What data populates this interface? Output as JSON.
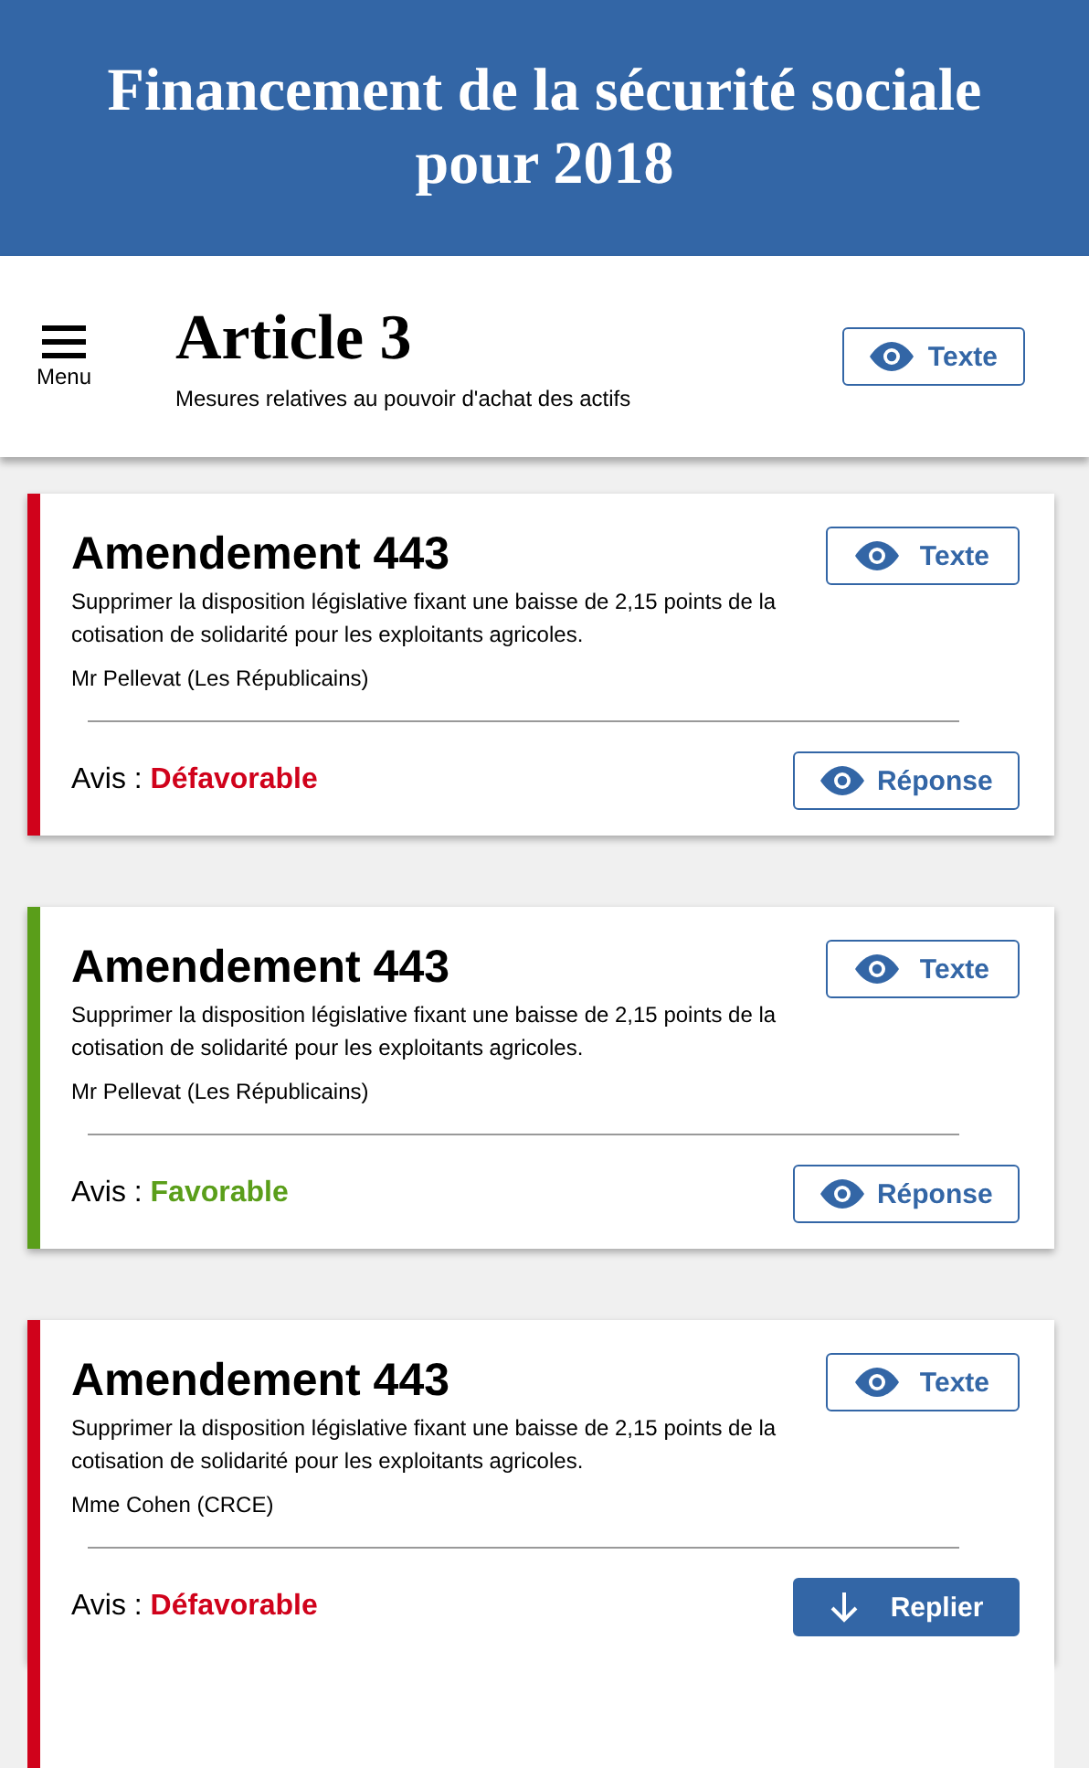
{
  "header": {
    "title": "Financement de la sécurité sociale pour 2018"
  },
  "nav": {
    "menu_label": "Menu",
    "title": "Article 3",
    "subtitle": "Mesures relatives au pouvoir d'achat des actifs",
    "text_button": "Texte"
  },
  "amendments": [
    {
      "title": "Amendement 443",
      "description": "Supprimer la disposition législative fixant une baisse de 2,15 points de la cotisation de solidarité pour les exploitants agricoles.",
      "author": "Mr Pellevat (Les Républicains)",
      "text_button": "Texte",
      "verdict_label": "Avis :",
      "verdict": "Défavorable",
      "color": "#d0021b",
      "expanded": false,
      "response_button": "Réponse"
    },
    {
      "title": "Amendement 443",
      "description": "Supprimer la disposition législative fixant une baisse de 2,15 points de la cotisation de solidarité pour les exploitants agricoles.",
      "author": "Mr Pellevat (Les Républicains)",
      "text_button": "Texte",
      "verdict_label": "Avis :",
      "verdict": "Favorable",
      "color": "#5a9e1a",
      "expanded": false,
      "response_button": "Réponse"
    },
    {
      "title": "Amendement 443",
      "description": "Supprimer la disposition législative fixant une baisse de 2,15 points de la cotisation de solidarité pour les exploitants agricoles.",
      "author": "Mme Cohen (CRCE)",
      "text_button": "Texte",
      "verdict_label": "Avis :",
      "verdict": "Défavorable",
      "color": "#d0021b",
      "expanded": true,
      "response_button": "Replier"
    }
  ]
}
